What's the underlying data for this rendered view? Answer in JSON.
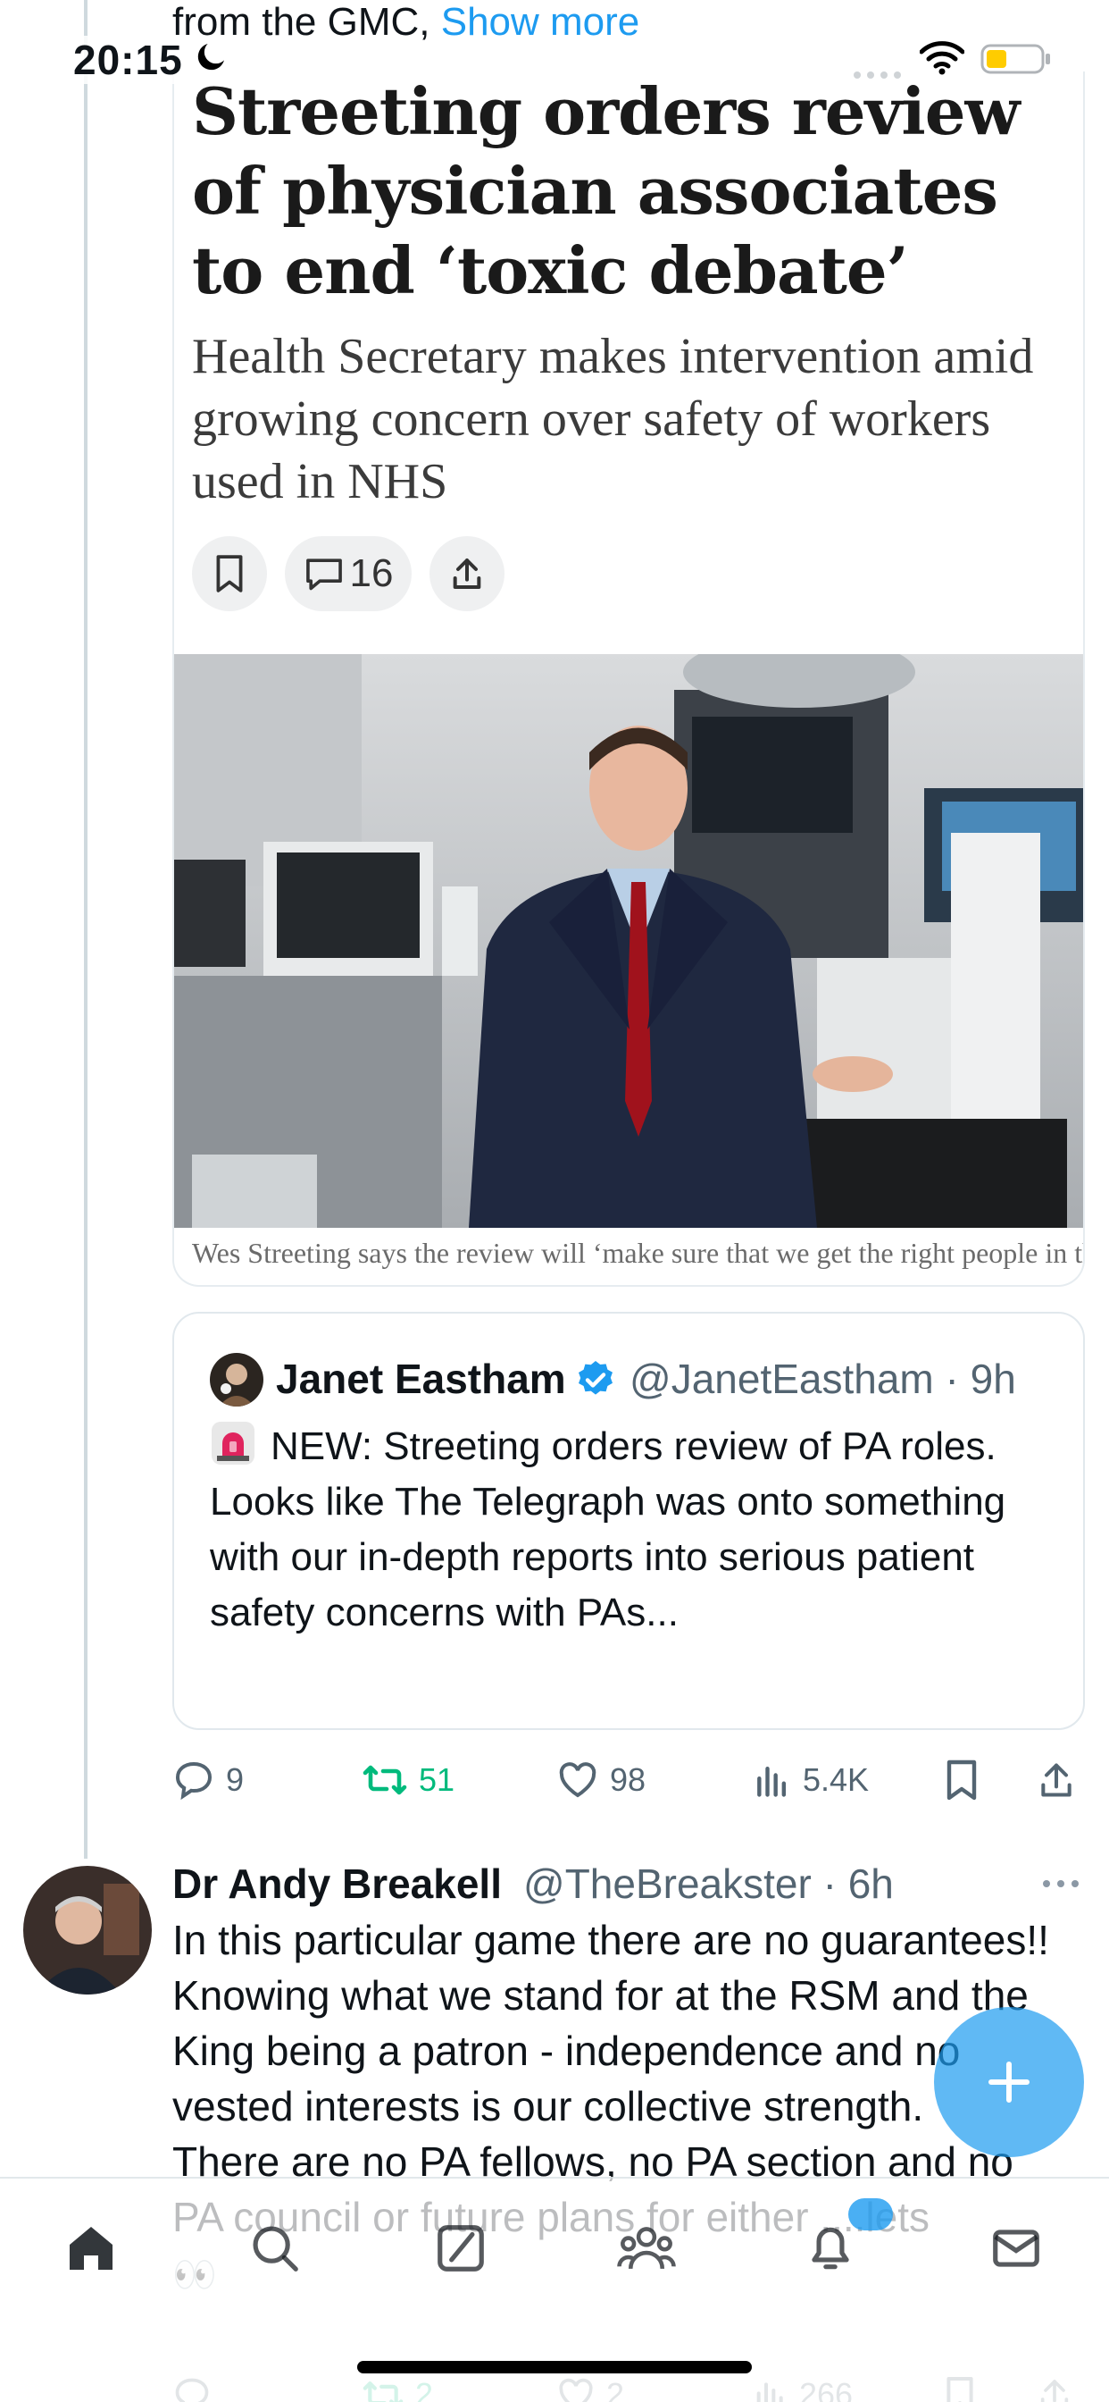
{
  "status_bar": {
    "time": "20:15"
  },
  "previous_tweet": {
    "truncated_text": "from the GMC, ",
    "show_more_label": "Show more"
  },
  "article": {
    "headline": "Streeting orders review of physician associates to end ‘toxic debate’",
    "subheadline": "Health Secretary makes intervention amid growing concern over safety of workers used in NHS",
    "comment_count": "16",
    "photo_caption": "Wes Streeting says the review will ‘make sure that we get the right people in the right place, doing the right thing’. Credit: Heathcliff"
  },
  "quoted_tweet": {
    "author_name": "Janet Eastham",
    "author_handle": "@JanetEastham",
    "time": "9h",
    "text": "NEW: Streeting orders review of PA roles.\nLooks like The Telegraph was onto something with our in-depth reports into serious patient safety concerns with PAs..."
  },
  "tweet_actions": {
    "replies": "9",
    "reposts": "51",
    "likes": "98",
    "views": "5.4K"
  },
  "reply_tweet": {
    "author_name": "Dr Andy Breakell",
    "author_handle": "@TheBreakster",
    "time": "6h",
    "text": "In this particular game there are no guarantees!!\nKnowing what we stand for at the RSM and the King being a patron - independence and no vested interests is our collective strength.\nThere are no PA fellows, no PA section and no PA council or future plans for either ....lets",
    "emoji": "👀",
    "replies": "",
    "reposts": "2",
    "likes": "2",
    "views": "266"
  },
  "colors": {
    "accent": "#1d9bf0",
    "repost_green": "#00ba7c",
    "muted_text": "#536471",
    "border": "#cfd9de"
  },
  "icons": [
    "moon-icon",
    "wifi-icon",
    "battery-icon",
    "bookmark-icon",
    "comment-icon",
    "share-icon",
    "verified-badge-icon",
    "siren-icon",
    "reply-icon",
    "repost-icon",
    "like-icon",
    "views-icon",
    "home-icon",
    "search-icon",
    "grok-icon",
    "communities-icon",
    "notifications-icon",
    "messages-icon",
    "compose-plus-icon",
    "more-icon"
  ]
}
